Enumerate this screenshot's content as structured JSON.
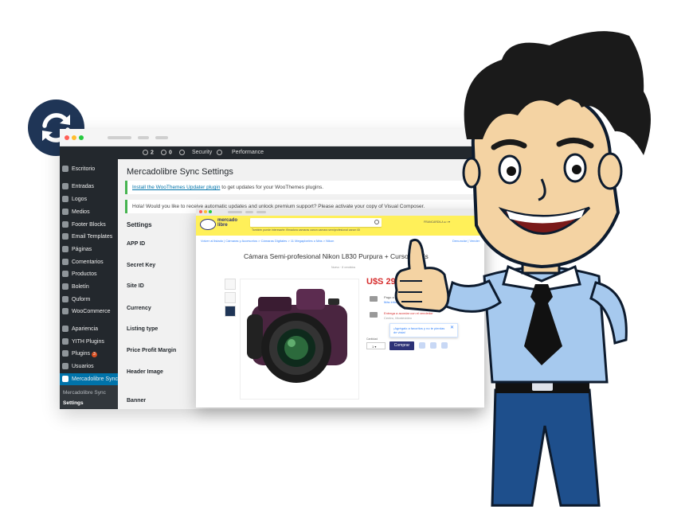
{
  "sync_badge": {
    "icon": "sync-icon",
    "color": "#1f3556"
  },
  "wp_admin_bar": {
    "updates_count": "2",
    "comments_count": "0",
    "items": [
      "Security",
      "Performance"
    ]
  },
  "wp_sidebar": {
    "items": [
      {
        "label": "Escritorio",
        "icon": "dashboard-icon"
      },
      {
        "label": "Entradas",
        "icon": "pin-icon"
      },
      {
        "label": "Logos",
        "icon": "image-icon"
      },
      {
        "label": "Medios",
        "icon": "media-icon"
      },
      {
        "label": "Footer Blocks",
        "icon": "pin-icon"
      },
      {
        "label": "Email Templates",
        "icon": "email-icon"
      },
      {
        "label": "Páginas",
        "icon": "page-icon"
      },
      {
        "label": "Comentarios",
        "icon": "comment-icon"
      },
      {
        "label": "Productos",
        "icon": "product-icon"
      },
      {
        "label": "Boletín",
        "icon": "newsletter-icon"
      },
      {
        "label": "Quform",
        "icon": "form-icon"
      },
      {
        "label": "WooCommerce",
        "icon": "woo-icon"
      },
      {
        "label": "Apariencia",
        "icon": "brush-icon"
      },
      {
        "label": "YITH Plugins",
        "icon": "plugin-icon"
      },
      {
        "label": "Plugins",
        "icon": "plugin-icon",
        "badge": "3"
      },
      {
        "label": "Usuarios",
        "icon": "user-icon"
      },
      {
        "label": "Mercadolibre Sync",
        "icon": "sync-icon",
        "active": true
      }
    ],
    "submenu": [
      "Mercadolibre Sync",
      "Settings"
    ]
  },
  "wp_page": {
    "title": "Mercadolibre Sync Settings",
    "notice1_link": "Install the WooThemes Updater plugin",
    "notice1_text": " to get updates for your WooThemes plugins.",
    "notice2_text": "Hola! Would you like to receive automatic updates and unlock premium support? Please activate your copy of Visual Composer.",
    "settings_heading": "Settings",
    "fields": [
      "APP ID",
      "Secret Key",
      "Site ID",
      "Currency",
      "Listing type",
      "Price Profit Margin",
      "Header Image",
      "Banner"
    ]
  },
  "ml_page": {
    "logo_line1": "mercado",
    "logo_line2": "libre",
    "nav_links": "También puede interesarte:  filmadora   camaras canon   camara semiprofesional   canon t3i",
    "user_text": "FRANCARDILA",
    "breadcrumb": "Volver al listado  |  Cámaras y Accesorios > Cámaras Digitales > 11 Megapixeles o Más > Nikon",
    "report_text": "Denunciar | Vender",
    "product_title": "Cámara Semi-profesional Nikon L830 Purpura + Curso Gratis",
    "product_subinfo": "Nuevo · 8 vendidos",
    "price": "U$S 299",
    "payment_text": "Pago a acordar con el vendedor",
    "payment_more": "Más información",
    "delivery_text": "Entrega a acordar con el vendedor",
    "location_text": "Centro, Montevideo",
    "tooltip_text": "¡Agrégalo a favoritos y no te pierdas de vista!",
    "qty_label": "Cantidad",
    "qty_value": "1",
    "buy_label": "Comprar",
    "accent": "#fff059",
    "brand": "#2d3277"
  }
}
